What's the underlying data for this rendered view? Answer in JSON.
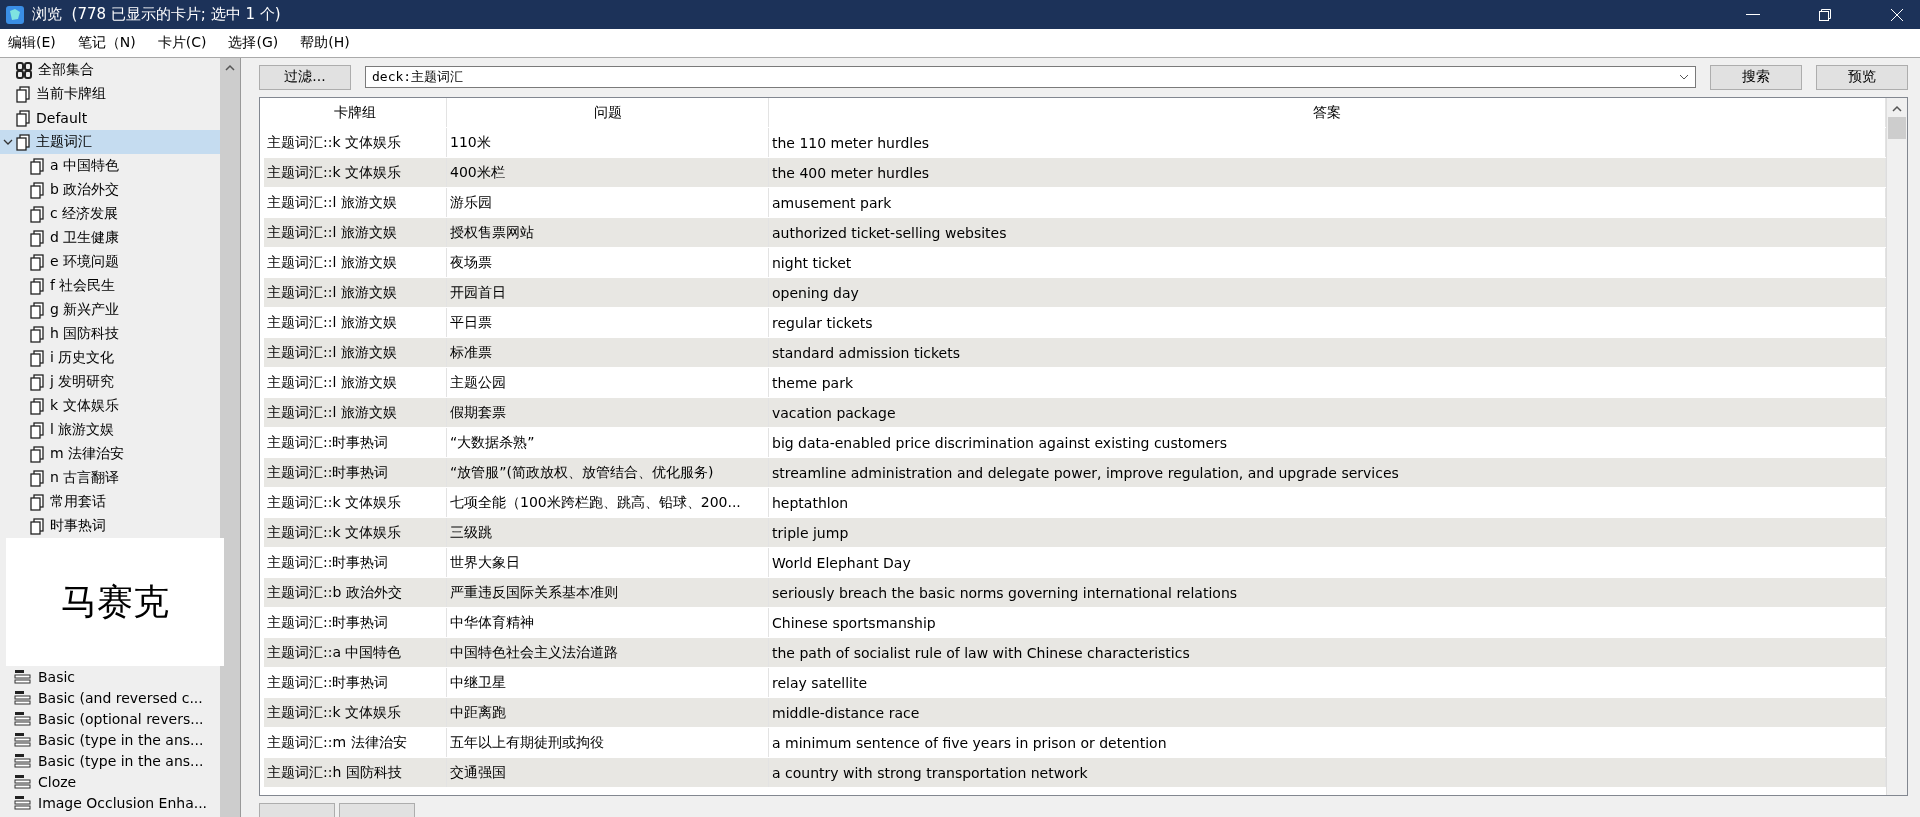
{
  "window": {
    "title": "浏览  (778 已显示的卡片; 选中 1 个)"
  },
  "menu": [
    "编辑(E)",
    "笔记（N)",
    "卡片(C)",
    "选择(G)",
    "帮助(H)"
  ],
  "sidebar": {
    "decks": [
      {
        "label": "全部集合",
        "kind": "collection",
        "selected": false
      },
      {
        "label": "当前卡牌组",
        "kind": "deck",
        "selected": false
      },
      {
        "label": "Default",
        "kind": "deck",
        "selected": false
      },
      {
        "label": "主题词汇",
        "kind": "deck",
        "selected": true,
        "expanded": true,
        "children": [
          {
            "label": "a 中国特色",
            "kind": "deck",
            "selected": false
          },
          {
            "label": "b 政治外交",
            "kind": "deck",
            "selected": false
          },
          {
            "label": "c 经济发展",
            "kind": "deck",
            "selected": false
          },
          {
            "label": "d 卫生健康",
            "kind": "deck",
            "selected": false
          },
          {
            "label": "e 环境问题",
            "kind": "deck",
            "selected": false
          },
          {
            "label": "f 社会民生",
            "kind": "deck",
            "selected": false
          },
          {
            "label": "g 新兴产业",
            "kind": "deck",
            "selected": false
          },
          {
            "label": "h 国防科技",
            "kind": "deck",
            "selected": false
          },
          {
            "label": "i 历史文化",
            "kind": "deck",
            "selected": false
          },
          {
            "label": "j 发明研究",
            "kind": "deck",
            "selected": false
          },
          {
            "label": "k 文体娱乐",
            "kind": "deck",
            "selected": false
          },
          {
            "label": "l 旅游文娱",
            "kind": "deck",
            "selected": false
          },
          {
            "label": "m 法律治安",
            "kind": "deck",
            "selected": false
          },
          {
            "label": "n 古言翻译",
            "kind": "deck",
            "selected": false
          },
          {
            "label": "常用套话",
            "kind": "deck",
            "selected": false
          },
          {
            "label": "时事热词",
            "kind": "deck",
            "selected": false
          }
        ]
      }
    ],
    "overlay_label": "马赛克",
    "note_types": [
      {
        "label": "Basic",
        "kind": "notetype",
        "selected": false
      },
      {
        "label": "Basic (and reversed c...",
        "kind": "notetype",
        "selected": false
      },
      {
        "label": "Basic (optional revers...",
        "kind": "notetype",
        "selected": false
      },
      {
        "label": "Basic (type in the ans...",
        "kind": "notetype",
        "selected": false
      },
      {
        "label": "Basic (type in the ans...",
        "kind": "notetype",
        "selected": false
      },
      {
        "label": "Cloze",
        "kind": "notetype",
        "selected": false
      },
      {
        "label": "Image Occlusion Enha...",
        "kind": "notetype",
        "selected": false
      }
    ]
  },
  "toolbar": {
    "filter_button": "过滤...",
    "search_value": "deck:主题词汇",
    "search_button": "搜索",
    "preview_button": "预览"
  },
  "table": {
    "columns": [
      "卡牌组",
      "问题",
      "答案"
    ],
    "rows": [
      [
        "主题词汇::k 文体娱乐",
        "110米",
        "the 110 meter hurdles"
      ],
      [
        "主题词汇::k 文体娱乐",
        "400米栏",
        "the 400 meter hurdles"
      ],
      [
        "主题词汇::l 旅游文娱",
        "游乐园",
        "amusement park"
      ],
      [
        "主题词汇::l 旅游文娱",
        "授权售票网站",
        "authorized ticket-selling websites"
      ],
      [
        "主题词汇::l 旅游文娱",
        "夜场票",
        "night ticket"
      ],
      [
        "主题词汇::l 旅游文娱",
        "开园首日",
        "opening day"
      ],
      [
        "主题词汇::l 旅游文娱",
        "平日票",
        "regular tickets"
      ],
      [
        "主题词汇::l 旅游文娱",
        "标准票",
        "standard admission tickets"
      ],
      [
        "主题词汇::l 旅游文娱",
        "主题公园",
        "theme park"
      ],
      [
        "主题词汇::l 旅游文娱",
        "假期套票",
        "vacation package"
      ],
      [
        "主题词汇::时事热词",
        "“大数据杀熟”",
        "big data-enabled price discrimination against existing customers"
      ],
      [
        "主题词汇::时事热词",
        "“放管服”(简政放权、放管结合、优化服务)",
        "streamline administration and delegate power, improve regulation, and upgrade services"
      ],
      [
        "主题词汇::k 文体娱乐",
        "七项全能（100米跨栏跑、跳高、铅球、200...",
        "heptathlon"
      ],
      [
        "主题词汇::k 文体娱乐",
        "三级跳",
        "triple jump"
      ],
      [
        "主题词汇::时事热词",
        "世界大象日",
        "World Elephant Day"
      ],
      [
        "主题词汇::b 政治外交",
        "严重违反国际关系基本准则",
        "seriously breach the basic norms governing international relations"
      ],
      [
        "主题词汇::时事热词",
        "中华体育精神",
        "Chinese sportsmanship"
      ],
      [
        "主题词汇::a 中国特色",
        "中国特色社会主义法治道路",
        "the path of socialist rule of law with Chinese characteristics"
      ],
      [
        "主题词汇::时事热词",
        "中继卫星",
        "relay satellite"
      ],
      [
        "主题词汇::k 文体娱乐",
        "中距离跑",
        "middle-distance race"
      ],
      [
        "主题词汇::m 法律治安",
        "五年以上有期徒刑或拘役",
        "a minimum sentence of five years in prison or detention"
      ],
      [
        "主题词汇::h 国防科技",
        "交通强国",
        "a country with strong transportation network"
      ]
    ]
  }
}
